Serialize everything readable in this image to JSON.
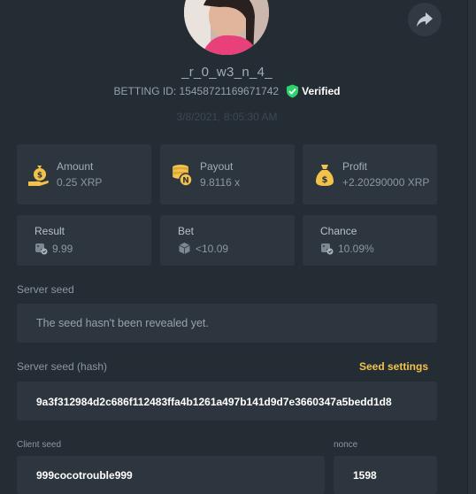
{
  "user": {
    "username": "_r_0_w3_n_4_",
    "betting_id": "BETTING ID: 15458721169671742",
    "verified_label": "Verified"
  },
  "bet": {
    "date": "3/8/2021, 8:05:30 AM"
  },
  "stats": {
    "amount": {
      "label": "Amount",
      "value": "0.25 XRP",
      "icon": "money-bag-hand-icon"
    },
    "payout": {
      "label": "Payout",
      "value": "9.8116 x",
      "icon": "coin-stack-icon"
    },
    "profit": {
      "label": "Profit",
      "value": "+2.20290000 XRP",
      "icon": "money-bag-icon"
    }
  },
  "details": {
    "result": {
      "label": "Result",
      "value": "9.99",
      "icon": "dice-check-icon"
    },
    "bet": {
      "label": "Bet",
      "value": "<10.09",
      "icon": "dice-icon"
    },
    "chance": {
      "label": "Chance",
      "value": "10.09%",
      "icon": "dice-check-icon"
    }
  },
  "seeds": {
    "server_seed_label": "Server seed",
    "server_seed_value": "The seed hasn't been revealed yet.",
    "server_hash_label": "Server seed (hash)",
    "seed_settings_label": "Seed settings",
    "server_hash_value": "9a3f312984d2c686f112483ffa4b1261a497b141d9d7e3660347a5bedd1d8",
    "client_seed_label": "Client seed",
    "client_seed_value": "999cocotrouble999",
    "nonce_label": "nonce",
    "nonce_value": "1598"
  },
  "colors": {
    "background": "#242c34",
    "card": "#2d363f",
    "accent_yellow": "#f2c24b",
    "verified_green": "#2bd46a"
  }
}
